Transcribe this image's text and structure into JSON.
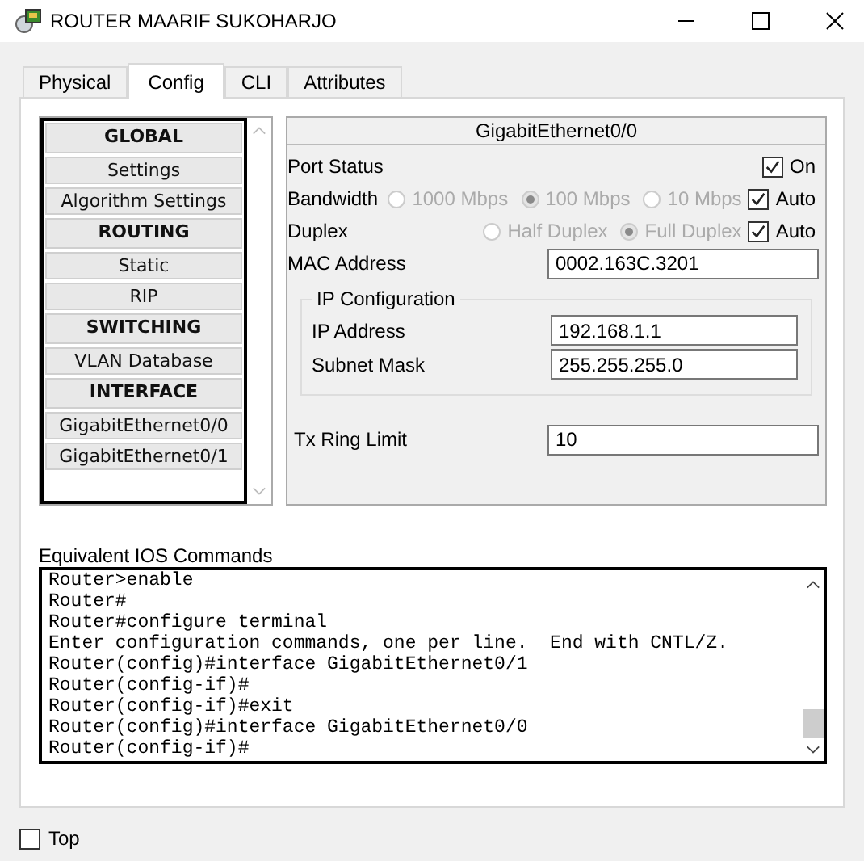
{
  "window": {
    "title": "ROUTER MAARIF SUKOHARJO"
  },
  "tabs": [
    {
      "label": "Physical",
      "selected": false
    },
    {
      "label": "Config",
      "selected": true
    },
    {
      "label": "CLI",
      "selected": false
    },
    {
      "label": "Attributes",
      "selected": false
    }
  ],
  "sidebar": {
    "items": [
      {
        "label": "GLOBAL",
        "kind": "header"
      },
      {
        "label": "Settings",
        "kind": "item"
      },
      {
        "label": "Algorithm Settings",
        "kind": "item"
      },
      {
        "label": "ROUTING",
        "kind": "header"
      },
      {
        "label": "Static",
        "kind": "item"
      },
      {
        "label": "RIP",
        "kind": "item"
      },
      {
        "label": "SWITCHING",
        "kind": "header"
      },
      {
        "label": "VLAN Database",
        "kind": "item"
      },
      {
        "label": "INTERFACE",
        "kind": "header"
      },
      {
        "label": "GigabitEthernet0/0",
        "kind": "item"
      },
      {
        "label": "GigabitEthernet0/1",
        "kind": "item"
      }
    ]
  },
  "interface": {
    "title": "GigabitEthernet0/0",
    "port_status": {
      "label": "Port Status",
      "checkbox_label": "On",
      "checked": true
    },
    "bandwidth": {
      "label": "Bandwidth",
      "disabled": true,
      "options": [
        {
          "label": "1000 Mbps",
          "selected": false
        },
        {
          "label": "100 Mbps",
          "selected": true
        },
        {
          "label": "10 Mbps",
          "selected": false
        }
      ],
      "auto": {
        "label": "Auto",
        "checked": true
      }
    },
    "duplex": {
      "label": "Duplex",
      "disabled": true,
      "options": [
        {
          "label": "Half Duplex",
          "selected": false
        },
        {
          "label": "Full Duplex",
          "selected": true
        }
      ],
      "auto": {
        "label": "Auto",
        "checked": true
      }
    },
    "mac_address": {
      "label": "MAC Address",
      "value": "0002.163C.3201"
    },
    "ip_configuration": {
      "title": "IP Configuration",
      "ip_address": {
        "label": "IP Address",
        "value": "192.168.1.1"
      },
      "subnet_mask": {
        "label": "Subnet Mask",
        "value": "255.255.255.0"
      }
    },
    "tx_ring_limit": {
      "label": "Tx Ring Limit",
      "value": "10"
    }
  },
  "ios_commands": {
    "label": "Equivalent IOS Commands",
    "lines": [
      "Router>enable",
      "Router#",
      "Router#configure terminal",
      "Enter configuration commands, one per line.  End with CNTL/Z.",
      "Router(config)#interface GigabitEthernet0/1",
      "Router(config-if)#",
      "Router(config-if)#exit",
      "Router(config)#interface GigabitEthernet0/0",
      "Router(config-if)#"
    ]
  },
  "top_checkbox": {
    "label": "Top",
    "checked": false
  }
}
